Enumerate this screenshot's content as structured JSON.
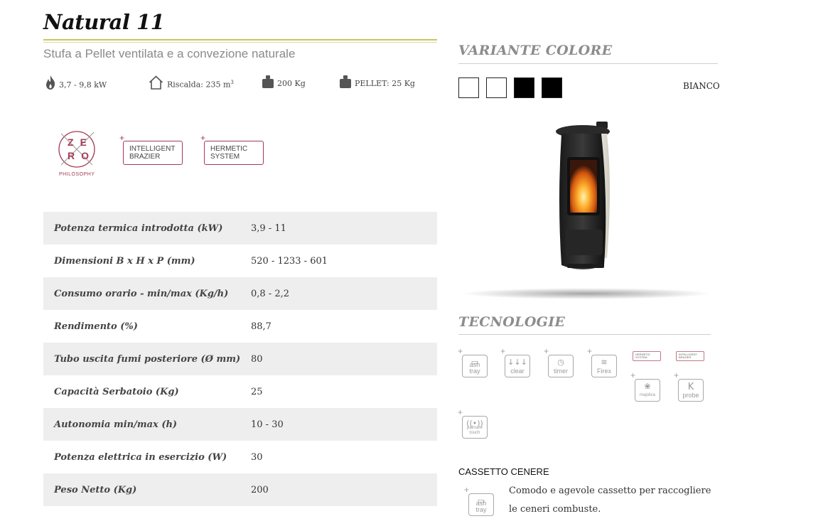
{
  "product": {
    "title": "Natural 11",
    "subtitle": "Stufa a Pellet ventilata e a convezione naturale"
  },
  "specs": [
    {
      "icon": "flame-icon",
      "text": "3,7 - 9,8 kW"
    },
    {
      "icon": "house-icon",
      "text": "Riscalda: 235 m",
      "sup": "3"
    },
    {
      "icon": "weight-icon",
      "text": "200 Kg"
    },
    {
      "icon": "weight-icon",
      "text": "PELLET: 25 Kg"
    }
  ],
  "badges": {
    "zero": {
      "letters": [
        "Z",
        "E",
        "R",
        "O"
      ],
      "caption": "PHILOSOPHY"
    },
    "intelligent": {
      "line1": "INTELLIGENT",
      "line2": "BRAZIER"
    },
    "hermetic": {
      "line1": "HERMETIC",
      "line2": "SYSTEM"
    }
  },
  "table": [
    {
      "label": "Potenza termica introdotta (kW)",
      "value": "3,9 - 11"
    },
    {
      "label": "Dimensioni B x H x P (mm)",
      "value": "520 - 1233 - 601"
    },
    {
      "label": "Consumo orario - min/max (Kg/h)",
      "value": "0,8 - 2,2"
    },
    {
      "label": "Rendimento (%)",
      "value": "88,7"
    },
    {
      "label": "Tubo uscita fumi posteriore (Ø mm)",
      "value": "80"
    },
    {
      "label": "Capacità Serbatoio (Kg)",
      "value": "25"
    },
    {
      "label": "Autonomia min/max (h)",
      "value": "10 - 30"
    },
    {
      "label": "Potenza elettrica in esercizio (W)",
      "value": "30"
    },
    {
      "label": "Peso Netto (Kg)",
      "value": "200"
    }
  ],
  "variant": {
    "title": "VARIANTE COLORE",
    "selected_label": "BIANCO",
    "swatches": [
      "#ffffff",
      "#ffffff",
      "#000000",
      "#000000"
    ]
  },
  "tech": {
    "title": "TECNOLOGIE",
    "icons": [
      {
        "name": "ash-tray",
        "line1": "ash",
        "line2": "tray"
      },
      {
        "name": "clear",
        "line1": "clear",
        "line2": ""
      },
      {
        "name": "timer",
        "line1": "timer",
        "line2": ""
      },
      {
        "name": "firex",
        "line1": "Firex",
        "line2": ""
      },
      {
        "name": "hermetic-system",
        "line1": "HERMETIC",
        "line2": "SYSTEM"
      },
      {
        "name": "intelligent-brazier",
        "line1": "INTELLIGENT",
        "line2": "BRAZIER"
      },
      {
        "name": "majolica",
        "line1": "majolica",
        "line2": ""
      },
      {
        "name": "k-probe",
        "line1": "probe",
        "line2": "",
        "glyph": "K"
      },
      {
        "name": "palmare-touch",
        "line1": "palmare",
        "line2": "touch"
      }
    ]
  },
  "ash_drawer": {
    "heading": "CASSETTO CENERE",
    "description": "Comodo e agevole cassetto per raccogliere le ceneri combuste.",
    "icon": {
      "line1": "ash",
      "line2": "tray"
    }
  },
  "colors": {
    "accent": "#a43a54",
    "title_rule": "#c8c65a",
    "row_bg": "#eeeeee"
  }
}
